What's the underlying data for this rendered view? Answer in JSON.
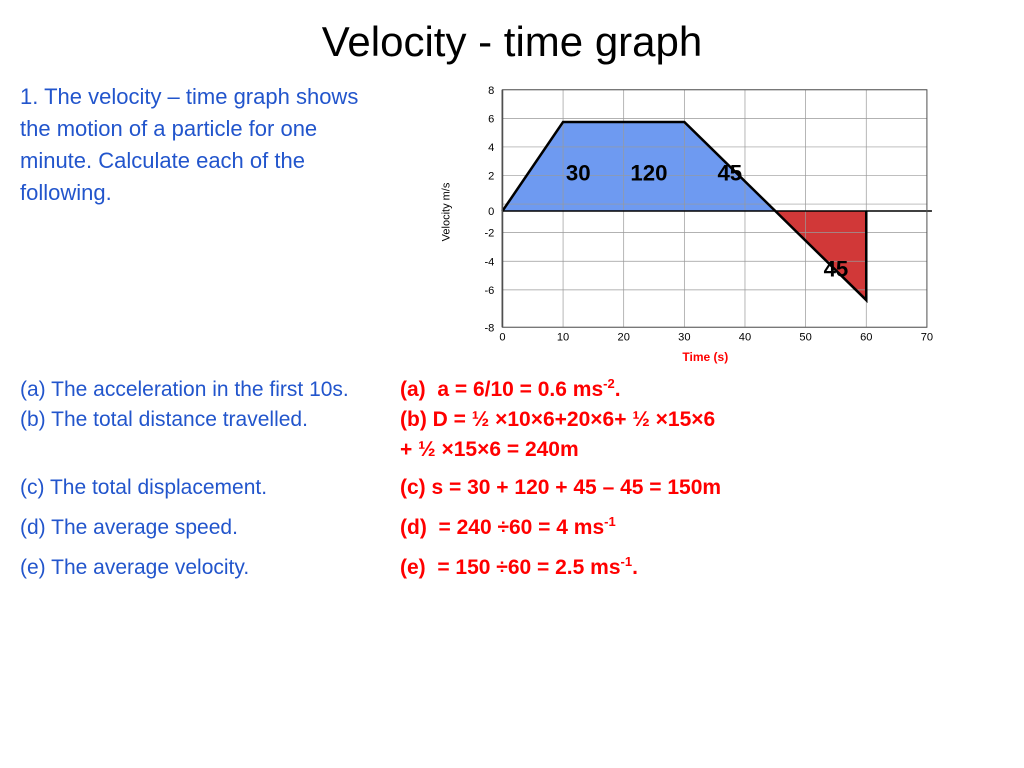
{
  "title": "Velocity -  time graph",
  "description": "1. The velocity – time graph shows the motion of a particle for one minute. Calculate each of the following.",
  "graph": {
    "y_label": "Velocity m/s",
    "x_label": "Time (s)",
    "y_max": 8,
    "y_min": -8,
    "x_max": 70,
    "x_min": 0,
    "x_ticks": [
      0,
      10,
      20,
      30,
      40,
      50,
      60,
      70
    ],
    "y_ticks": [
      -8,
      -6,
      -4,
      -2,
      0,
      2,
      4,
      6,
      8
    ],
    "areas": [
      {
        "label": "30",
        "color": "#4488ff",
        "points": "blue_trap"
      },
      {
        "label": "120",
        "color": "#4488ff",
        "points": "blue_rect"
      },
      {
        "label": "45",
        "color": "#4488ff",
        "points": "blue_trap2"
      },
      {
        "label": "45",
        "color": "#cc2222",
        "points": "red_trap"
      }
    ]
  },
  "qa": [
    {
      "question": "(a) The acceleration in the first 10s.",
      "answer": "(a)  a = 6/10 = 0.6 ms",
      "answer_sup": "-2",
      "answer_suffix": ".",
      "extra_line": null
    },
    {
      "question": "(b) The total distance travelled.",
      "answer": "(b) D = ½ ×10×6+20×6+ ½ ×15×6",
      "answer_sup": "",
      "answer_suffix": "",
      "extra_line": "+ ½ ×15×6 = 240m"
    },
    {
      "question": "(c) The total displacement.",
      "answer": "(c) s = 30 + 120 + 45 – 45 = 150m",
      "answer_sup": "",
      "answer_suffix": "",
      "extra_line": null
    },
    {
      "question": "(d) The average speed.",
      "answer": "(d)  = 240 ÷60 = 4 ms",
      "answer_sup": "-1",
      "answer_suffix": "",
      "extra_line": null
    },
    {
      "question": "(e) The average velocity.",
      "answer": "(e)  = 150 ÷60 = 2.5 ms",
      "answer_sup": "-1",
      "answer_suffix": ".",
      "extra_line": null
    }
  ]
}
